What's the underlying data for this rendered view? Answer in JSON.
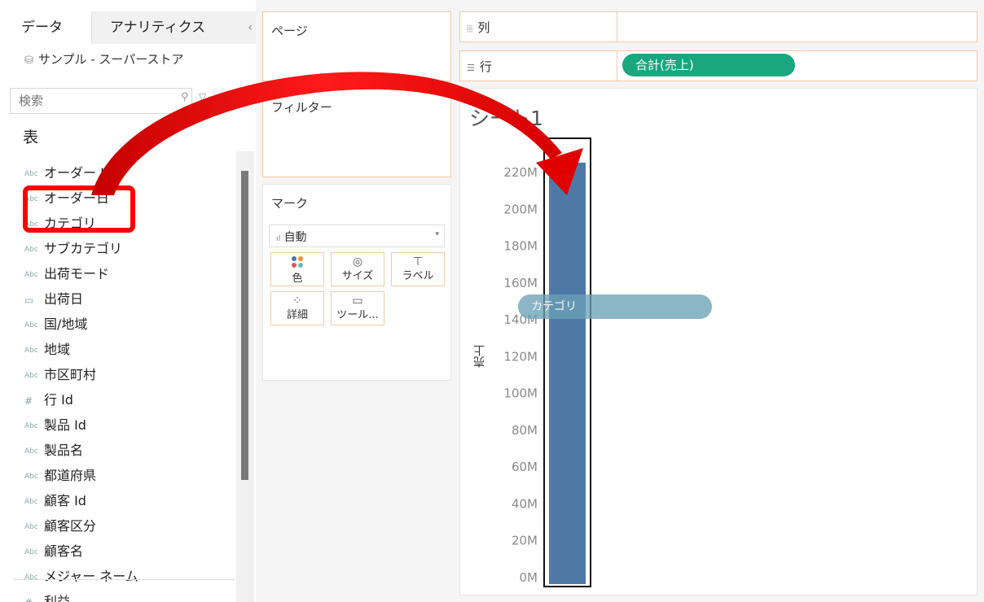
{
  "left_pane": {
    "tabs": {
      "data": "データ",
      "analytics": "アナリティクス",
      "collapse": "‹"
    },
    "datasource": "サンプル - スーパーストア",
    "search_placeholder": "検索",
    "table_heading": "表",
    "fields": [
      {
        "type": "Abc",
        "label": "オーダー Id"
      },
      {
        "type": "Abc",
        "label": "オーダー日"
      },
      {
        "type": "Abc",
        "label": "カテゴリ"
      },
      {
        "type": "Abc",
        "label": "サブカテゴリ"
      },
      {
        "type": "Abc",
        "label": "出荷モード"
      },
      {
        "type": "date",
        "label": "出荷日"
      },
      {
        "type": "Abc",
        "label": "国/地域"
      },
      {
        "type": "Abc",
        "label": "地域"
      },
      {
        "type": "Abc",
        "label": "市区町村"
      },
      {
        "type": "#",
        "label": "行 Id"
      },
      {
        "type": "Abc",
        "label": "製品 Id"
      },
      {
        "type": "Abc",
        "label": "製品名"
      },
      {
        "type": "Abc",
        "label": "都道府県"
      },
      {
        "type": "Abc",
        "label": "顧客 Id"
      },
      {
        "type": "Abc",
        "label": "顧客区分"
      },
      {
        "type": "Abc",
        "label": "顧客名"
      },
      {
        "type": "Abc",
        "label": "メジャー ネーム"
      },
      {
        "type": "#",
        "label": "利益"
      }
    ]
  },
  "shelves": {
    "pages": "ページ",
    "filters": "フィルター",
    "marks": "マーク",
    "mark_type": "自動",
    "mark_buttons": {
      "color": "色",
      "size": "サイズ",
      "label": "ラベル",
      "detail": "詳細",
      "tooltip": "ツール..."
    },
    "columns": "列",
    "rows": "行",
    "rows_pill": "合計(売上)"
  },
  "sheet": {
    "title": "シート1",
    "drag_pill": "カテゴリ"
  },
  "colors": {
    "bar": "#4e79a7",
    "pill_green": "#1aa67e",
    "highlight_red": "#ff0000",
    "shelf_border": "#f2c9a8"
  },
  "chart_data": {
    "type": "bar",
    "categories": [
      ""
    ],
    "values": [
      228
    ],
    "ylabel": "売上",
    "unit": "M",
    "ylim": [
      0,
      240
    ],
    "ticks": [
      "0M",
      "20M",
      "40M",
      "60M",
      "80M",
      "100M",
      "120M",
      "140M",
      "160M",
      "180M",
      "200M",
      "220M"
    ]
  }
}
